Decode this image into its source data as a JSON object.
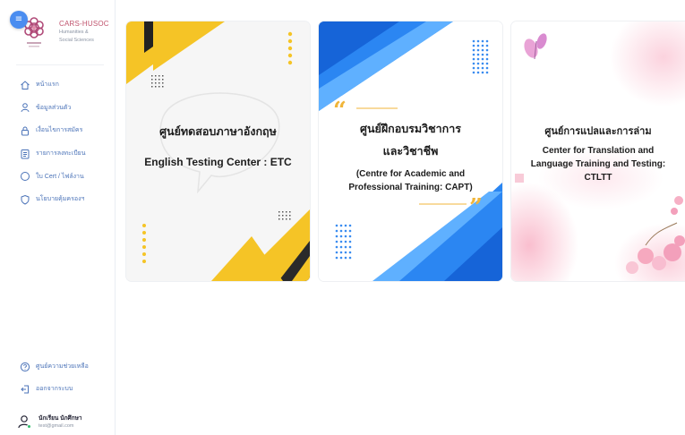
{
  "brand": {
    "title": "CARS-HUSOC",
    "subtitle_line1": "Humanities &",
    "subtitle_line2": "Social Sciences"
  },
  "sidebar": {
    "menu_icon": "hamburger-icon",
    "items": [
      {
        "label": "หน้าแรก",
        "icon": "home-icon"
      },
      {
        "label": "ข้อมูลส่วนตัว",
        "icon": "user-icon"
      },
      {
        "label": "เงื่อนไขการสมัคร",
        "icon": "lock-icon"
      },
      {
        "label": "รายการลงทะเบียน",
        "icon": "list-icon"
      },
      {
        "label": "ใบ Cert / ไฟล์งาน",
        "icon": "circle-icon"
      },
      {
        "label": "นโยบายคุ้มครองฯ",
        "icon": "shield-icon"
      }
    ],
    "bottom_items": [
      {
        "label": "ศูนย์ความช่วยเหลือ",
        "icon": "help-icon"
      },
      {
        "label": "ออกจากระบบ",
        "icon": "logout-icon"
      }
    ]
  },
  "user": {
    "name": "นักเรียน นักศึกษา",
    "email": "test@gmail.com"
  },
  "cards": [
    {
      "title_th": "ศูนย์ทดสอบภาษาอังกฤษ",
      "title_en": "English Testing Center : ETC",
      "accent": "#f5c426"
    },
    {
      "title_th_line1": "ศูนย์ฝึกอบรมวิชาการ",
      "title_th_line2": "และวิชาชีพ",
      "title_en_line1": "(Centre for Academic and",
      "title_en_line2": "Professional Training: CAPT)",
      "accent": "#1f7ef0",
      "quote_color": "#f0b53a"
    },
    {
      "title_th": "ศูนย์การแปลและการล่าม",
      "title_en_line1": "Center for Translation and",
      "title_en_line2": "Language Training and Testing:",
      "title_en_line3": "CTLTT",
      "accent": "#f7b5c9"
    }
  ]
}
